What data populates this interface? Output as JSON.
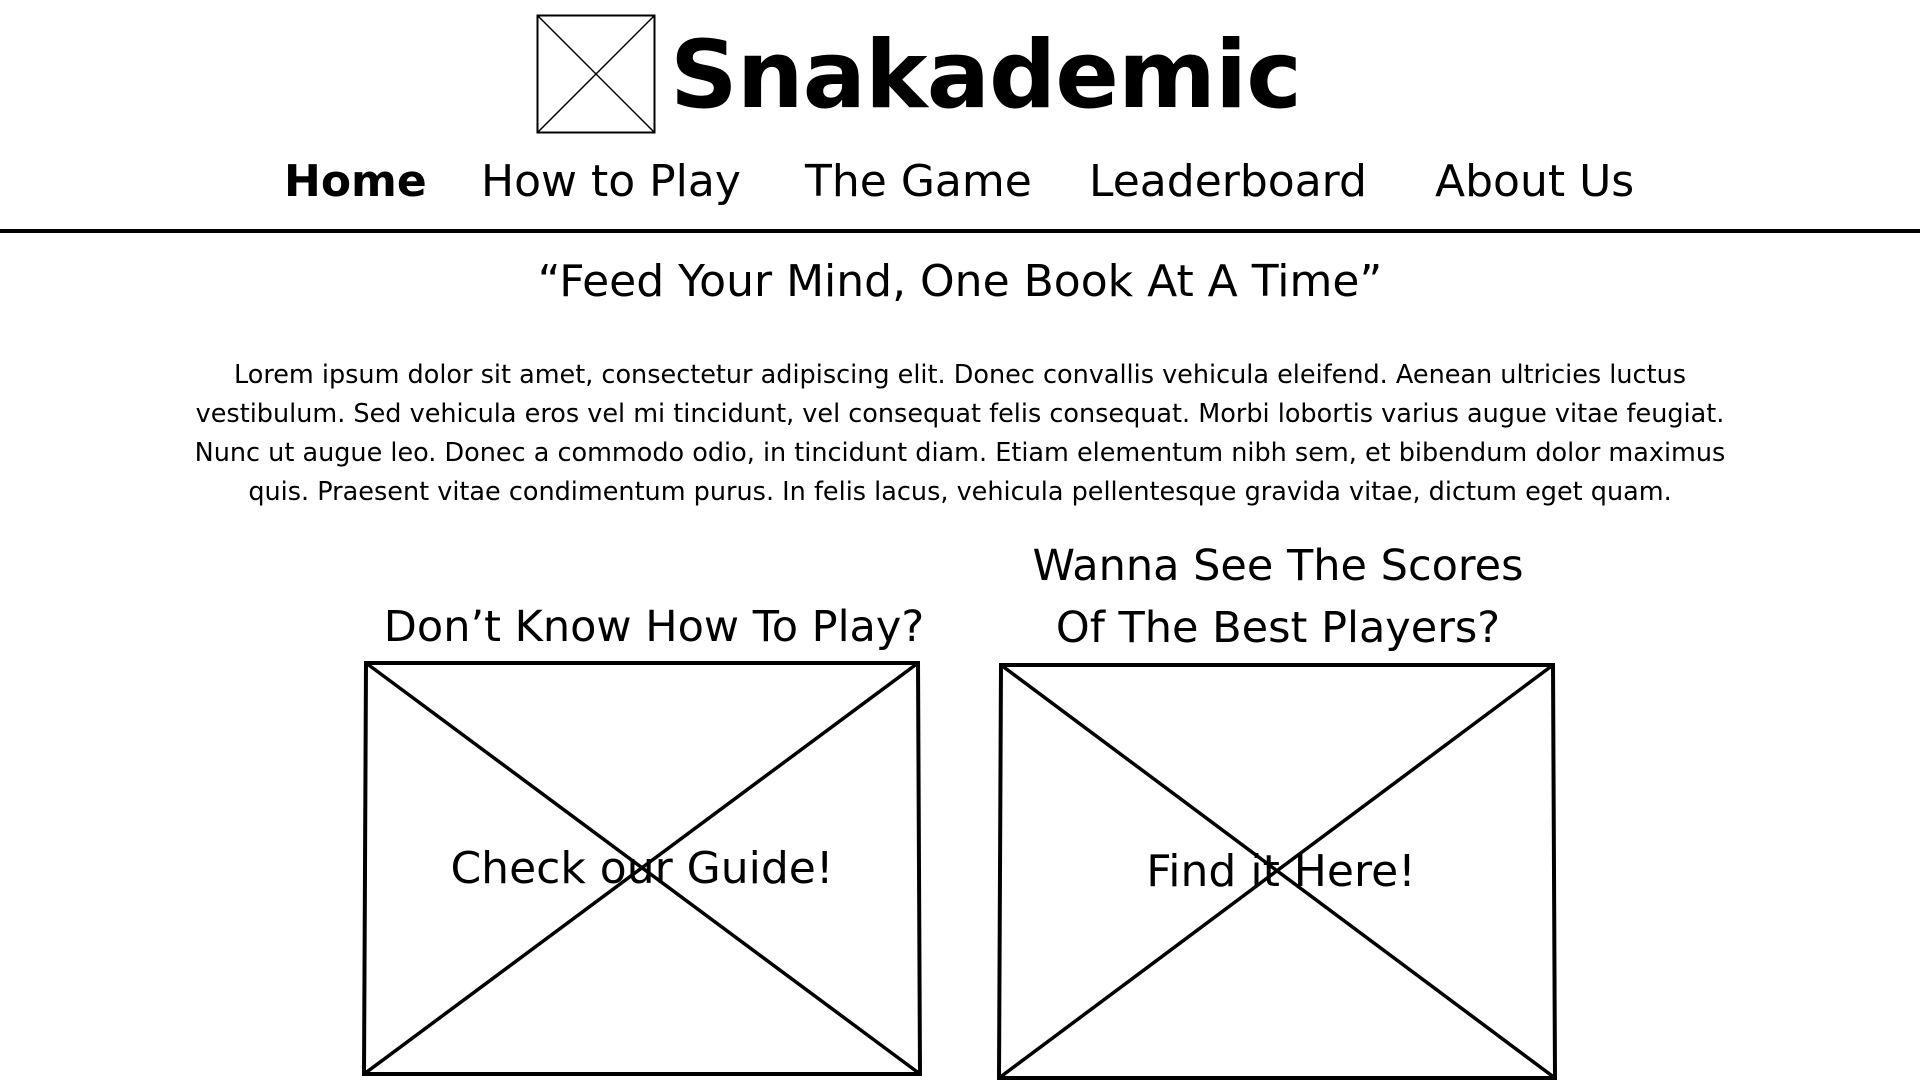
{
  "header": {
    "logo_icon": "image-placeholder-icon",
    "title": "Snakademic"
  },
  "nav": {
    "items": [
      {
        "label": "Home",
        "active": true
      },
      {
        "label": "How to Play",
        "active": false
      },
      {
        "label": "The Game",
        "active": false
      },
      {
        "label": "Leaderboard",
        "active": false
      },
      {
        "label": "About Us",
        "active": false
      }
    ]
  },
  "hero": {
    "tagline": "“Feed Your Mind, One Book At A Time”",
    "body": "Lorem ipsum dolor sit amet, consectetur adipiscing elit. Donec convallis vehicula eleifend. Aenean ultricies luctus vestibulum. Sed vehicula eros vel mi tincidunt, vel consequat felis consequat. Morbi lobortis varius augue vitae feugiat. Nunc ut augue leo. Donec a commodo odio, in tincidunt diam. Etiam elementum nibh sem, et bibendum dolor maximus quis. Praesent vitae condimentum purus. In felis lacus, vehicula pellentesque gravida vitae, dictum eget quam."
  },
  "cards": [
    {
      "heading_lines": [
        "Don’t Know How To Play?"
      ],
      "label": "Check our Guide!",
      "icon": "image-placeholder-icon"
    },
    {
      "heading_lines": [
        "Wanna See The Scores",
        "Of The Best Players?"
      ],
      "label": "Find it Here!",
      "icon": "image-placeholder-icon"
    }
  ],
  "colors": {
    "background": "#ffffff",
    "foreground": "#000000"
  }
}
